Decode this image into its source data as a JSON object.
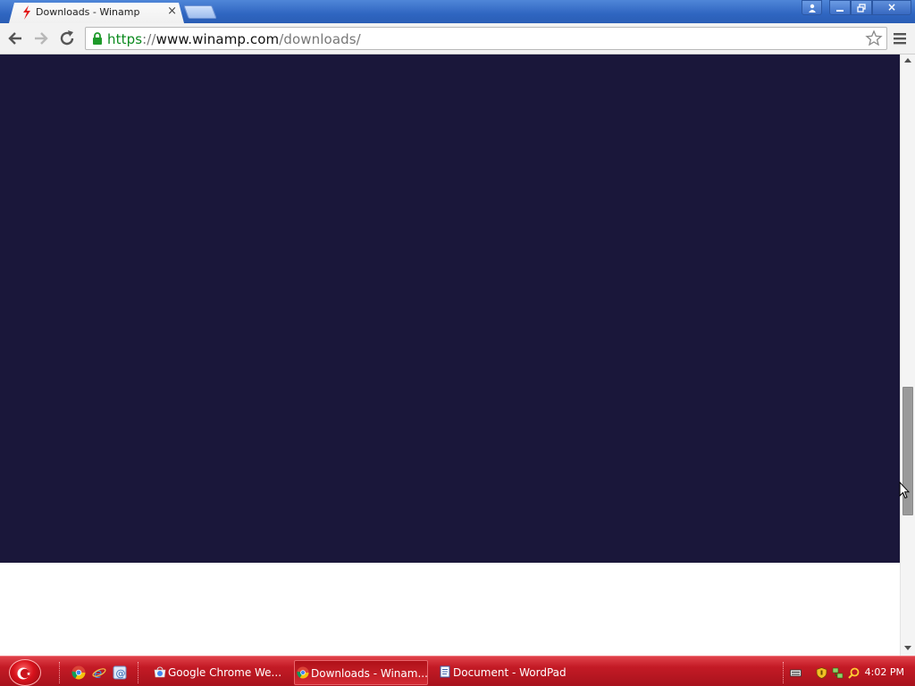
{
  "browser": {
    "tab": {
      "title": "Downloads - Winamp",
      "close": "×"
    },
    "window_controls": {
      "user": "user-icon",
      "minimize": "minimize-icon",
      "restore": "restore-icon",
      "close": "×"
    },
    "address": {
      "scheme": "https",
      "sep": "://",
      "host": "www.winamp.com",
      "path": "/downloads/"
    }
  },
  "page": {
    "panel_color": "#1a173a",
    "background": "#ffffff"
  },
  "scrollbar": {
    "position_percent": 60
  },
  "taskbar": {
    "color": "#c41b26",
    "tasks": [
      {
        "label": "Google Chrome We...",
        "icon": "chrome-web-store-icon",
        "active": false
      },
      {
        "label": "Downloads - Winam...",
        "icon": "chrome-icon",
        "active": true
      },
      {
        "label": "Document - WordPad",
        "icon": "wordpad-icon",
        "active": false
      }
    ],
    "quick_launch": [
      "chrome-icon",
      "internet-explorer-icon",
      "settings-icon"
    ],
    "clock": "4:02 PM"
  }
}
